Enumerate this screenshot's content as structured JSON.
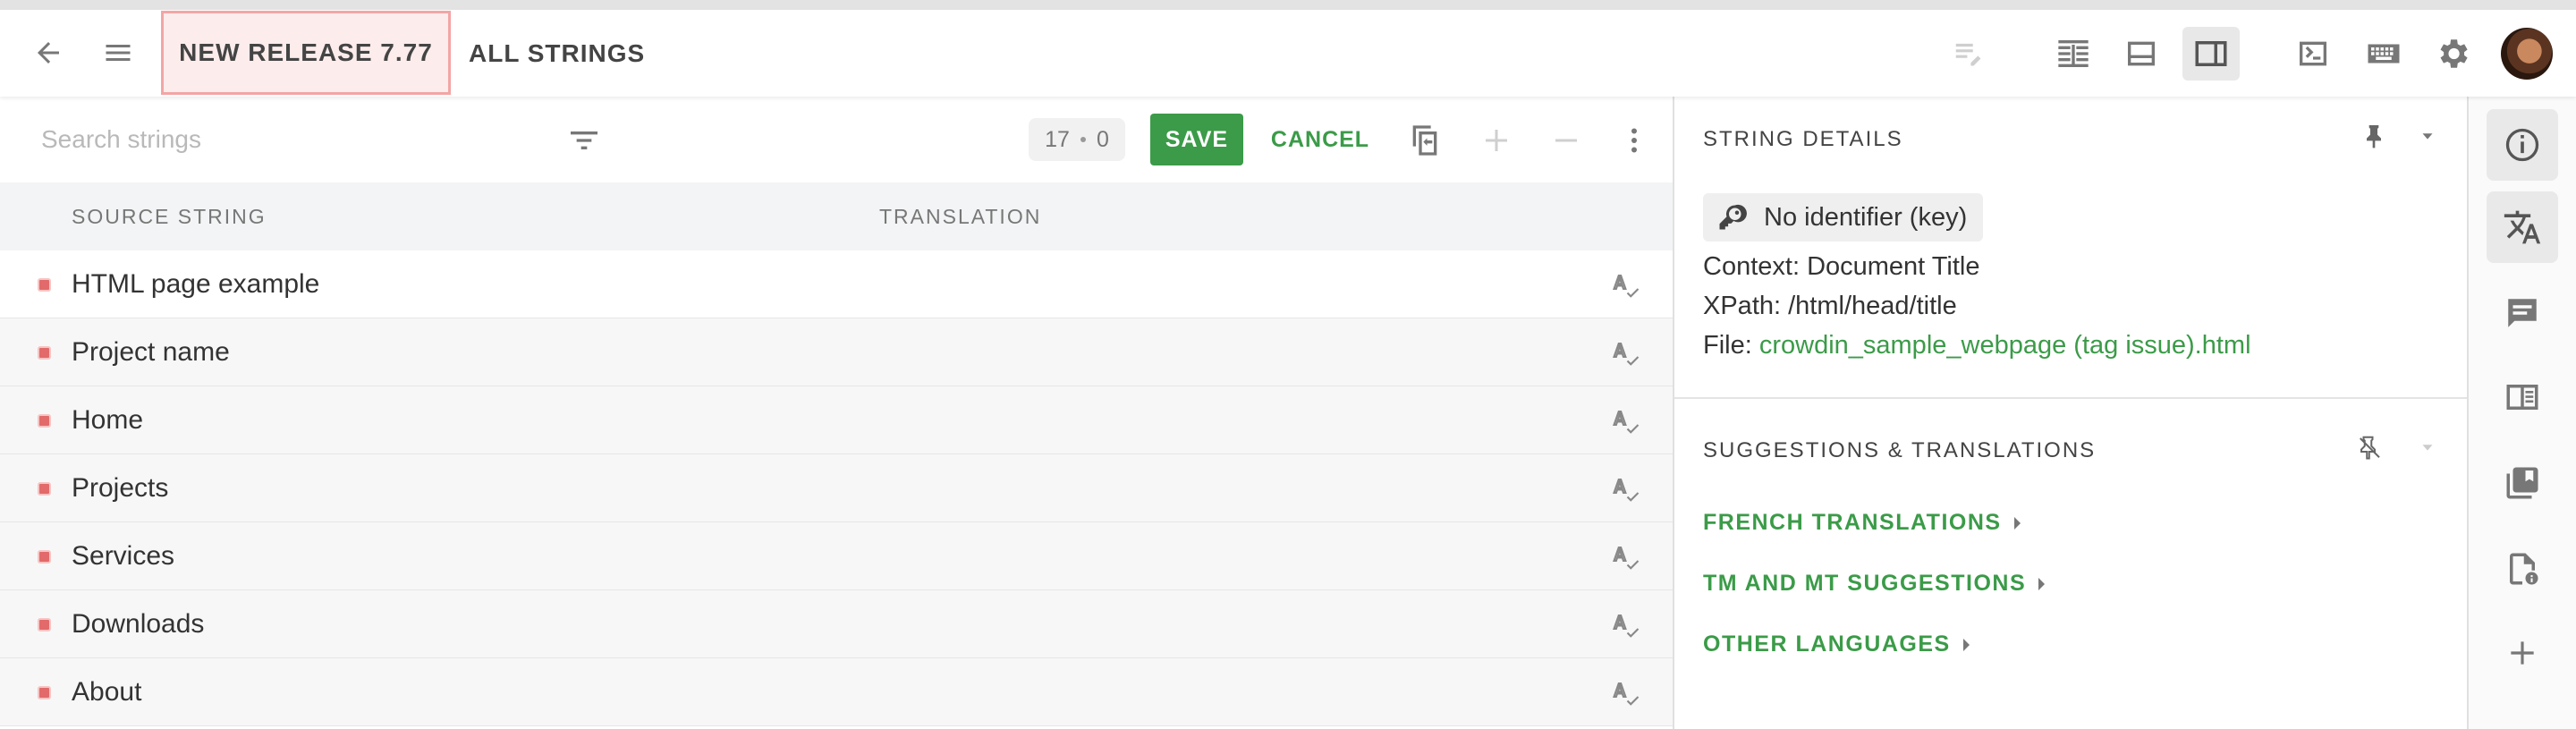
{
  "header": {
    "breadcrumb_project": "NEW RELEASE 7.77",
    "breadcrumb_view": "ALL STRINGS"
  },
  "toolbar": {
    "search_placeholder": "Search strings",
    "counter_left": "17",
    "counter_right": "0",
    "save_label": "SAVE",
    "cancel_label": "CANCEL"
  },
  "table": {
    "col_source": "SOURCE STRING",
    "col_translation": "TRANSLATION",
    "rows": [
      {
        "text": "HTML page example"
      },
      {
        "text": "Project name"
      },
      {
        "text": "Home"
      },
      {
        "text": "Projects"
      },
      {
        "text": "Services"
      },
      {
        "text": "Downloads"
      },
      {
        "text": "About"
      }
    ]
  },
  "details": {
    "string_details_title": "STRING DETAILS",
    "identifier": "No identifier (key)",
    "context_label": "Context: ",
    "context_value": "Document Title",
    "xpath_label": "XPath: ",
    "xpath_value": "/html/head/title",
    "file_label": "File: ",
    "file_value": "crowdin_sample_webpage (tag issue).html",
    "suggestions_title": "SUGGESTIONS & TRANSLATIONS",
    "expanders": [
      "FRENCH TRANSLATIONS",
      "TM AND MT SUGGESTIONS",
      "OTHER LANGUAGES"
    ]
  },
  "colors": {
    "accent_green": "#3b9b48",
    "untranslated_marker": "#e26a6a"
  },
  "icons": {
    "header": [
      "back-arrow-icon",
      "menu-icon",
      "edit-disabled-icon",
      "layout-side-by-side-icon",
      "layout-bottom-icon",
      "layout-right-panel-icon",
      "terminal-icon",
      "keyboard-icon",
      "settings-icon"
    ],
    "rail": [
      "info-icon",
      "translate-icon",
      "comment-icon",
      "reader-icon",
      "library-icon",
      "file-info-icon",
      "add-icon"
    ]
  }
}
